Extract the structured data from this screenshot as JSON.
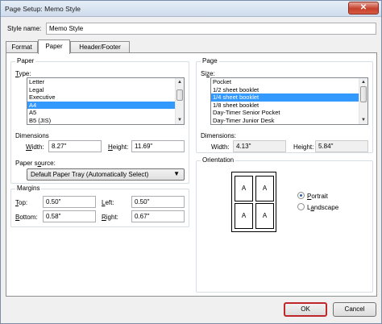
{
  "window": {
    "title": "Page Setup: Memo Style",
    "close_glyph": "✕"
  },
  "style_name": {
    "label": "Style name:",
    "value": "Memo Style"
  },
  "tabs": [
    {
      "label": "Format",
      "active": false
    },
    {
      "label": "Paper",
      "active": true
    },
    {
      "label": "Header/Footer",
      "active": false
    }
  ],
  "paper": {
    "group_title": "Paper",
    "type_label": "Type:",
    "type_items": [
      "Letter",
      "Legal",
      "Executive",
      "A4",
      "A5",
      "B5 (JIS)"
    ],
    "type_selected_index": 3,
    "dimensions_label": "Dimensions",
    "width_label": "Width:",
    "width_value": "8.27\"",
    "height_label": "Height:",
    "height_value": "11.69\"",
    "source_label": "Paper source:",
    "source_value": "Default Paper Tray (Automatically Select)"
  },
  "margins": {
    "group_title": "Margins",
    "top_label": "Top:",
    "top_value": "0.50\"",
    "left_label": "Left:",
    "left_value": "0.50\"",
    "bottom_label": "Bottom:",
    "bottom_value": "0.58\"",
    "right_label": "Right:",
    "right_value": "0.67\""
  },
  "page": {
    "group_title": "Page",
    "size_label": "Size:",
    "size_items": [
      "Pocket",
      "1/2 sheet booklet",
      "1/4 sheet booklet",
      "1/8 sheet booklet",
      "Day-Timer Senior Pocket",
      "Day-Timer Junior Desk"
    ],
    "size_selected_index": 2,
    "dimensions_label": "Dimensions:",
    "width_label": "Width:",
    "width_value": "4.13\"",
    "height_label": "Height:",
    "height_value": "5.84\""
  },
  "orientation": {
    "group_title": "Orientation",
    "preview_cells": [
      "A",
      "A",
      "A",
      "A"
    ],
    "portrait_label": "Portrait",
    "landscape_label": "Landscape",
    "selected": "portrait"
  },
  "buttons": {
    "ok_label": "OK",
    "cancel_label": "Cancel"
  },
  "colors": {
    "selection": "#3399ff",
    "default_button_border": "#c0272d",
    "close_button": "#c5412c"
  },
  "icons": {
    "close": "close-icon",
    "scroll_up": "chevron-up-icon",
    "scroll_down": "chevron-down-icon",
    "dropdown": "chevron-down-icon"
  }
}
